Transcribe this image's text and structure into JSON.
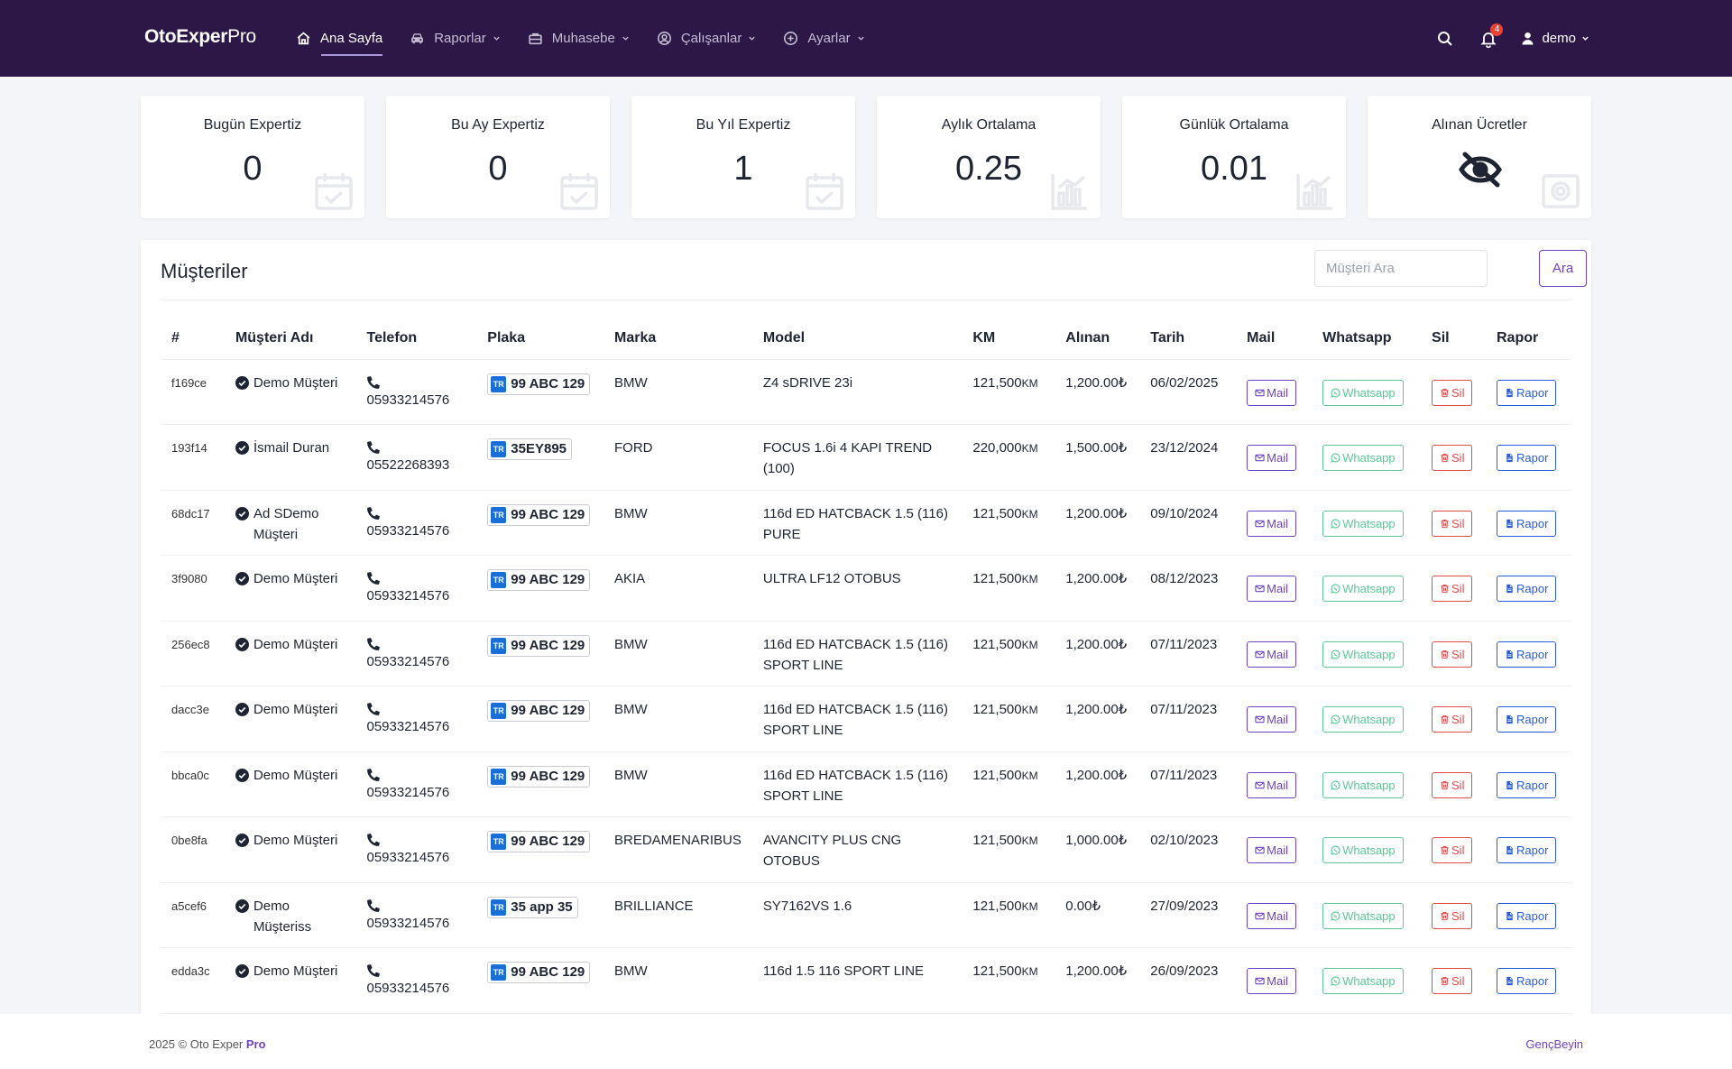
{
  "app": {
    "brand_main": "OtoExper",
    "brand_suffix": "Pro"
  },
  "nav": [
    {
      "label": "Ana Sayfa",
      "icon": "home-icon",
      "active": true
    },
    {
      "label": "Raporlar",
      "icon": "car-icon",
      "dropdown": true
    },
    {
      "label": "Muhasebe",
      "icon": "briefcase-icon",
      "dropdown": true
    },
    {
      "label": "Çalışanlar",
      "icon": "user-circle-icon",
      "dropdown": true
    },
    {
      "label": "Ayarlar",
      "icon": "plus-circle-icon",
      "dropdown": true
    }
  ],
  "header": {
    "notification_count": "4",
    "user_name": "demo"
  },
  "stats": [
    {
      "label": "Bugün Expertiz",
      "value": "0",
      "icon": "calendar-check-icon"
    },
    {
      "label": "Bu Ay Expertiz",
      "value": "0",
      "icon": "calendar-check-icon"
    },
    {
      "label": "Bu Yıl Expertiz",
      "value": "1",
      "icon": "calendar-check-icon"
    },
    {
      "label": "Aylık Ortalama",
      "value": "0.25",
      "icon": "bar-chart-icon"
    },
    {
      "label": "Günlük Ortalama",
      "value": "0.01",
      "icon": "bar-chart-icon"
    },
    {
      "label": "Alınan Ücretler",
      "value": "",
      "icon": "eye-slash-icon"
    }
  ],
  "customers": {
    "title": "Müşteriler",
    "search_placeholder": "Müşteri Ara",
    "search_button": "Ara",
    "columns": [
      "#",
      "Müşteri Adı",
      "Telefon",
      "Plaka",
      "Marka",
      "Model",
      "KM",
      "Alınan",
      "Tarih",
      "Mail",
      "Whatsapp",
      "Sil",
      "Rapor"
    ],
    "buttons": {
      "mail": "Mail",
      "whatsapp": "Whatsapp",
      "sil": "Sil",
      "rapor": "Rapor"
    },
    "km_unit": "KM",
    "plate_country": "TR",
    "rows": [
      {
        "id": "f169ce",
        "name": "Demo Müşteri",
        "phone": "05933214576",
        "plate": "99 ABC 129",
        "brand": "BMW",
        "model": "Z4 sDRIVE 23i",
        "km": "121,500",
        "amount": "1,200.00₺",
        "date": "06/02/2025"
      },
      {
        "id": "193f14",
        "name": "İsmail Duran",
        "phone": "05522268393",
        "plate": "35EY895",
        "brand": "FORD",
        "model": "FOCUS 1.6i 4 KAPI TREND (100)",
        "km": "220,000",
        "amount": "1,500.00₺",
        "date": "23/12/2024"
      },
      {
        "id": "68dc17",
        "name": "Ad SDemo Müşteri",
        "phone": "05933214576",
        "plate": "99 ABC 129",
        "brand": "BMW",
        "model": "116d ED HATCBACK 1.5 (116) PURE",
        "km": "121,500",
        "amount": "1,200.00₺",
        "date": "09/10/2024"
      },
      {
        "id": "3f9080",
        "name": "Demo Müşteri",
        "phone": "05933214576",
        "plate": "99 ABC 129",
        "brand": "AKIA",
        "model": "ULTRA LF12 OTOBUS",
        "km": "121,500",
        "amount": "1,200.00₺",
        "date": "08/12/2023"
      },
      {
        "id": "256ec8",
        "name": "Demo Müşteri",
        "phone": "05933214576",
        "plate": "99 ABC 129",
        "brand": "BMW",
        "model": "116d ED HATCBACK 1.5 (116) SPORT LINE",
        "km": "121,500",
        "amount": "1,200.00₺",
        "date": "07/11/2023"
      },
      {
        "id": "dacc3e",
        "name": "Demo Müşteri",
        "phone": "05933214576",
        "plate": "99 ABC 129",
        "brand": "BMW",
        "model": "116d ED HATCBACK 1.5 (116) SPORT LINE",
        "km": "121,500",
        "amount": "1,200.00₺",
        "date": "07/11/2023"
      },
      {
        "id": "bbca0c",
        "name": "Demo Müşteri",
        "phone": "05933214576",
        "plate": "99 ABC 129",
        "brand": "BMW",
        "model": "116d ED HATCBACK 1.5 (116) SPORT LINE",
        "km": "121,500",
        "amount": "1,200.00₺",
        "date": "07/11/2023"
      },
      {
        "id": "0be8fa",
        "name": "Demo Müşteri",
        "phone": "05933214576",
        "plate": "99 ABC 129",
        "brand": "BREDAMENARIBUS",
        "model": "AVANCITY PLUS CNG OTOBUS",
        "km": "121,500",
        "amount": "1,000.00₺",
        "date": "02/10/2023"
      },
      {
        "id": "a5cef6",
        "name": "Demo Müşteriss",
        "phone": "05933214576",
        "plate": "35 app 35",
        "brand": "BRILLIANCE",
        "model": "SY7162VS 1.6",
        "km": "121,500",
        "amount": "0.00₺",
        "date": "27/09/2023"
      },
      {
        "id": "edda3c",
        "name": "Demo Müşteri",
        "phone": "05933214576",
        "plate": "99 ABC 129",
        "brand": "BMW",
        "model": "116d 1.5 116 SPORT LINE",
        "km": "121,500",
        "amount": "1,200.00₺",
        "date": "26/09/2023"
      }
    ]
  },
  "footer": {
    "copyright_prefix": "2025 © Oto Exper ",
    "copyright_brand": "Pro",
    "credit": "GençBeyin"
  },
  "colors": {
    "header_bg": "#2c1747",
    "accent": "#6f42c1",
    "whatsapp": "#5cc996",
    "danger": "#e04b4b",
    "report": "#2b5cd6",
    "plate_tr": "#1a6ed8"
  }
}
